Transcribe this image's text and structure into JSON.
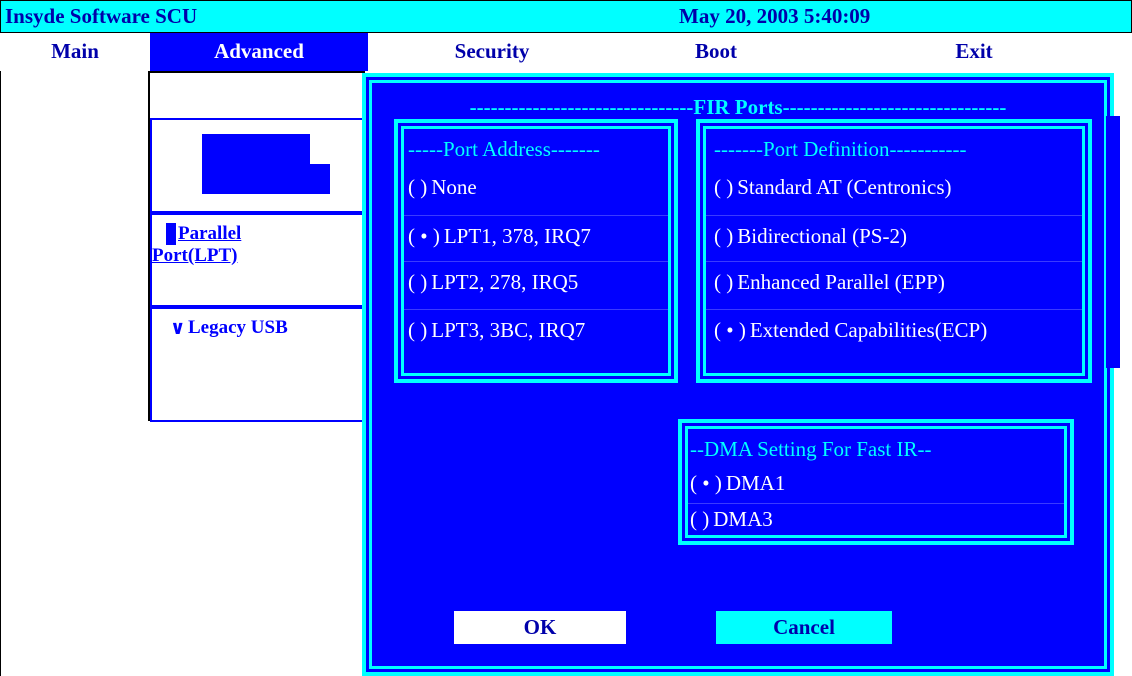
{
  "titlebar": {
    "app_title": "Insyde Software SCU",
    "datetime": "May 20, 2003 5:40:09"
  },
  "menu": {
    "items": [
      "Main",
      "Advanced",
      "Security",
      "Boot",
      "Exit"
    ],
    "active": "Advanced"
  },
  "sidebar": {
    "parallel_port": "Parallel Port(LPT)",
    "legacy_usb_prefix": "∨",
    "legacy_usb": "Legacy USB"
  },
  "dialog": {
    "title": "--------------------------------FIR Ports--------------------------------",
    "port_address": {
      "title": "-----Port Address-------",
      "options": [
        {
          "radio": "(   )",
          "label": "None"
        },
        {
          "radio": "( • )",
          "label": "LPT1, 378, IRQ7"
        },
        {
          "radio": "(   )",
          "label": "LPT2, 278, IRQ5"
        },
        {
          "radio": "(   )",
          "label": "LPT3, 3BC, IRQ7"
        }
      ]
    },
    "port_definition": {
      "title": "-------Port Definition-----------",
      "options": [
        {
          "radio": "(   )",
          "label": "Standard AT (Centronics)"
        },
        {
          "radio": "(   )",
          "label": "Bidirectional (PS-2)"
        },
        {
          "radio": "(   )",
          "label": "Enhanced Parallel (EPP)"
        },
        {
          "radio": "( • )",
          "label": "Extended Capabilities(ECP)"
        }
      ]
    },
    "dma": {
      "title": "--DMA Setting For Fast IR--",
      "options": [
        {
          "radio": "( • )",
          "label": "DMA1"
        },
        {
          "radio": "(   )",
          "label": "DMA3"
        }
      ]
    },
    "ok_label": "OK",
    "cancel_label": "Cancel"
  },
  "colors": {
    "cyan": "#00ffff",
    "blue": "#0000ff",
    "dark_blue": "#0000aa",
    "white": "#ffffff"
  }
}
